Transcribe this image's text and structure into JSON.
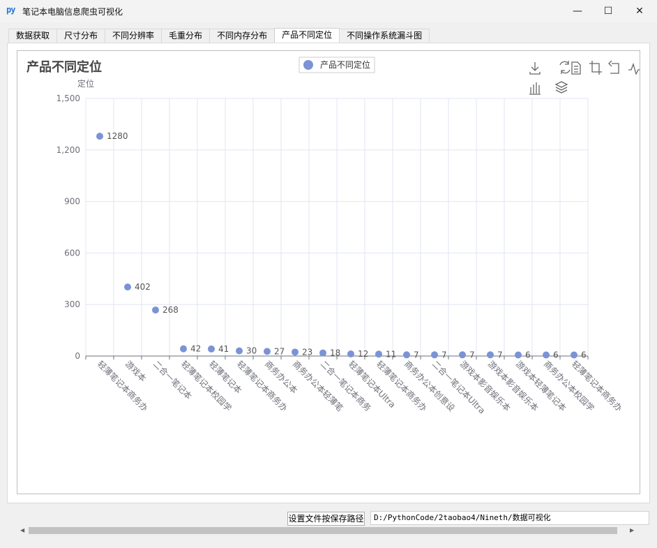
{
  "window": {
    "icon_text": "py",
    "title": "笔记本电脑信息爬虫可视化",
    "min_glyph": "—",
    "max_glyph": "☐",
    "close_glyph": "✕"
  },
  "tabs": [
    {
      "label": "数据获取"
    },
    {
      "label": "尺寸分布"
    },
    {
      "label": "不同分辨率"
    },
    {
      "label": "毛重分布"
    },
    {
      "label": "不同内存分布"
    },
    {
      "label": "产品不同定位",
      "active": true
    },
    {
      "label": "不同操作系统漏斗图"
    }
  ],
  "toolbox": [
    "download-icon",
    "refresh-icon",
    "data-view-icon",
    "crop-icon",
    "undo-icon",
    "line-chart-icon",
    "bar-chart-icon",
    "stack-icon"
  ],
  "chart_data": {
    "type": "scatter",
    "title": "产品不同定位",
    "ylabel": "定位",
    "legend": {
      "name": "产品不同定位",
      "position": "top-center"
    },
    "series_color": "#7b93d6",
    "categories": [
      "轻薄笔记本商务办",
      "游戏本",
      "二合一笔记本",
      "轻薄笔记本校园学",
      "轻薄笔记本",
      "轻薄笔记本商务办",
      "商务办公本",
      "商务办公本轻薄笔",
      "二合一笔记本商务",
      "轻薄笔记本Ultra",
      "轻薄笔记本商务办",
      "商务办公本创意设",
      "二合一笔记本Ultra",
      "游戏本影音娱乐本",
      "游戏本影音娱乐本",
      "游戏本轻薄笔记本",
      "商务办公本校园学",
      "轻薄笔记本商务办"
    ],
    "values": [
      1280,
      402,
      268,
      42,
      41,
      30,
      27,
      23,
      18,
      12,
      11,
      7,
      7,
      7,
      7,
      6,
      6,
      6
    ],
    "ylim": [
      0,
      1500
    ],
    "yticks": [
      "0",
      "300",
      "600",
      "900",
      "1,200",
      "1,500"
    ],
    "grid": true
  },
  "footer": {
    "save_button": "设置文件按保存路径",
    "path": "D:/PythonCode/2taobao4/Nineth/数据可视化"
  }
}
